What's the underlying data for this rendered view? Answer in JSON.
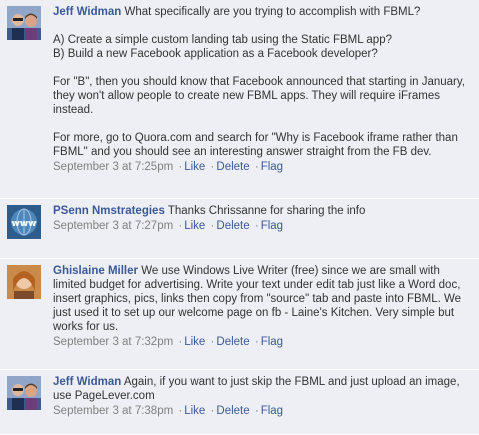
{
  "comments": [
    {
      "author": "Jeff Widman",
      "avatar_icon": "user-photo-icon",
      "paragraphs": [
        "What specifically are you trying to accomplish with FBML?",
        "A) Create a simple custom landing tab using the Static FBML app?\nB) Build a new Facebook application as a Facebook developer?",
        "For \"B\", then you should know that Facebook announced that starting in January, they won't allow people to create new FBML apps. They will require iFrames instead.",
        "For more, go to Quora.com and search for \"Why is Facebook iframe rather than FBML\" and you should see an interesting answer straight from the FB dev."
      ],
      "timestamp": "September 3 at 7:25pm",
      "like_label": "Like",
      "delete_label": "Delete",
      "flag_label": "Flag"
    },
    {
      "author": "PSenn Nmstrategies",
      "avatar_icon": "www-globe-icon",
      "paragraphs": [
        "Thanks Chrissanne for sharing the info"
      ],
      "timestamp": "September 3 at 7:27pm",
      "like_label": "Like",
      "delete_label": "Delete",
      "flag_label": "Flag"
    },
    {
      "author": "Ghislaine Miller",
      "avatar_icon": "user-photo-icon",
      "paragraphs": [
        "We use Windows Live Writer (free) since we are small with limited budget for advertising. Write your text under edit tab just like a Word doc, insert graphics, pics, links then copy from \"source\" tab and paste into FBML. We just used it to set up our welcome page on fb - Laine's Kitchen. Very simple but works for us."
      ],
      "timestamp": "September 3 at 7:32pm",
      "like_label": "Like",
      "delete_label": "Delete",
      "flag_label": "Flag"
    },
    {
      "author": "Jeff Widman",
      "avatar_icon": "user-photo-icon",
      "paragraphs": [
        "Again, if you want to just skip the FBML and just upload an image, use PageLever.com"
      ],
      "timestamp": "September 3 at 7:38pm",
      "like_label": "Like",
      "delete_label": "Delete",
      "flag_label": "Flag"
    }
  ],
  "colors": {
    "link": "#3b5998",
    "comment_bg": "#edeff4",
    "meta": "#808080"
  }
}
